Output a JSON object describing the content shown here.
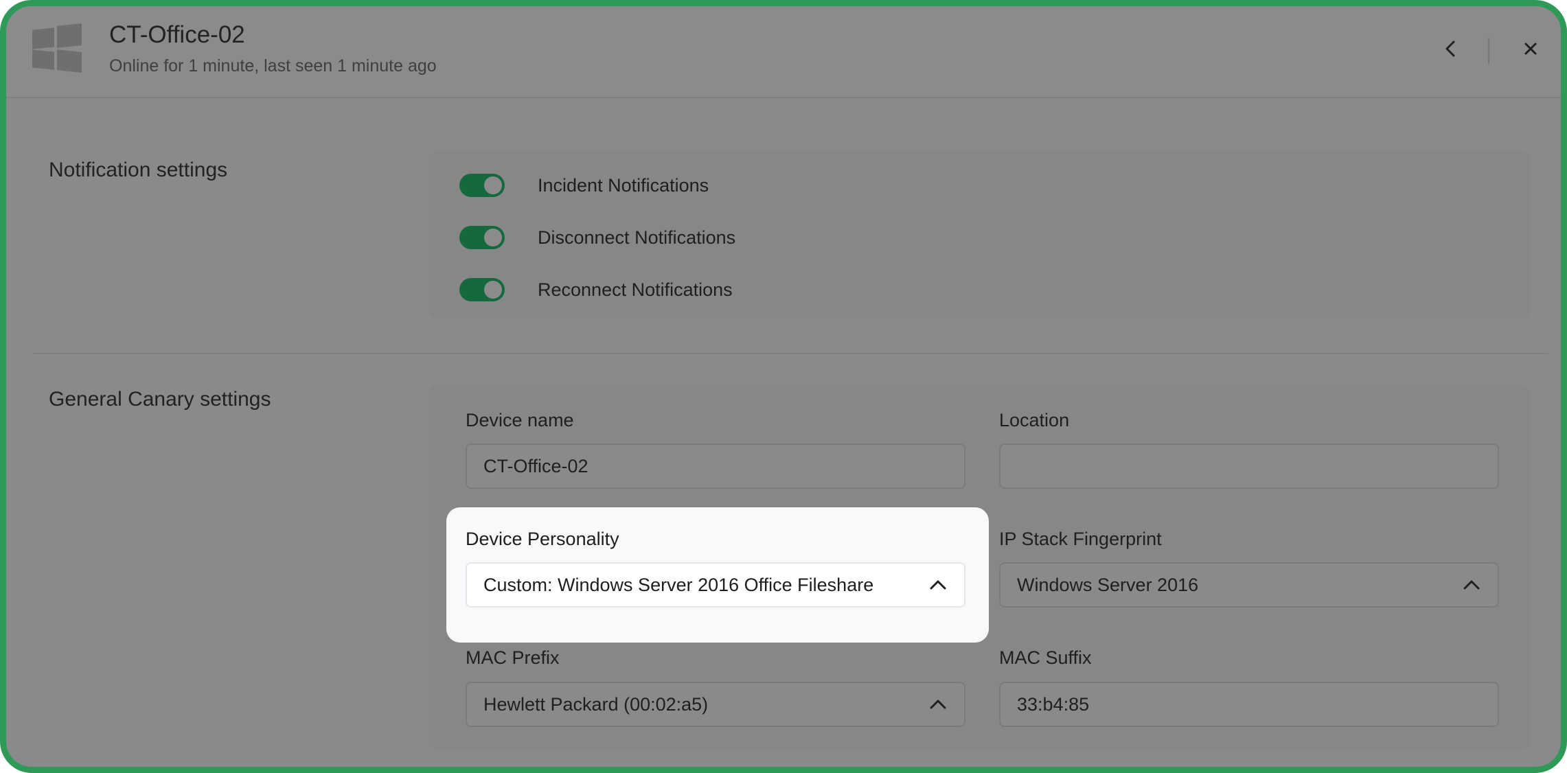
{
  "header": {
    "title": "CT-Office-02",
    "subtitle": "Online for 1 minute, last seen 1 minute ago",
    "logo_icon": "windows-logo-icon",
    "back_icon": "chevron-left-icon",
    "close_icon": "close-icon"
  },
  "notification_settings": {
    "label": "Notification settings",
    "toggles": [
      {
        "label": "Incident Notifications",
        "on": true
      },
      {
        "label": "Disconnect Notifications",
        "on": true
      },
      {
        "label": "Reconnect Notifications",
        "on": true
      }
    ]
  },
  "general_settings": {
    "label": "General Canary settings",
    "device_name": {
      "label": "Device name",
      "value": "CT-Office-02"
    },
    "location": {
      "label": "Location",
      "value": ""
    },
    "device_personality": {
      "label": "Device Personality",
      "value": "Custom: Windows Server 2016 Office Fileshare"
    },
    "ip_stack_fingerprint": {
      "label": "IP Stack Fingerprint",
      "value": "Windows Server 2016"
    },
    "mac_prefix": {
      "label": "MAC Prefix",
      "value": "Hewlett Packard (00:02:a5)"
    },
    "mac_suffix": {
      "label": "MAC Suffix",
      "value": "33:b4:85"
    }
  },
  "colors": {
    "frame_border": "#2f9a57",
    "toggle_on": "#16683d",
    "overlay": "#8a8a8a",
    "highlight_bg": "#f8f9fb"
  }
}
